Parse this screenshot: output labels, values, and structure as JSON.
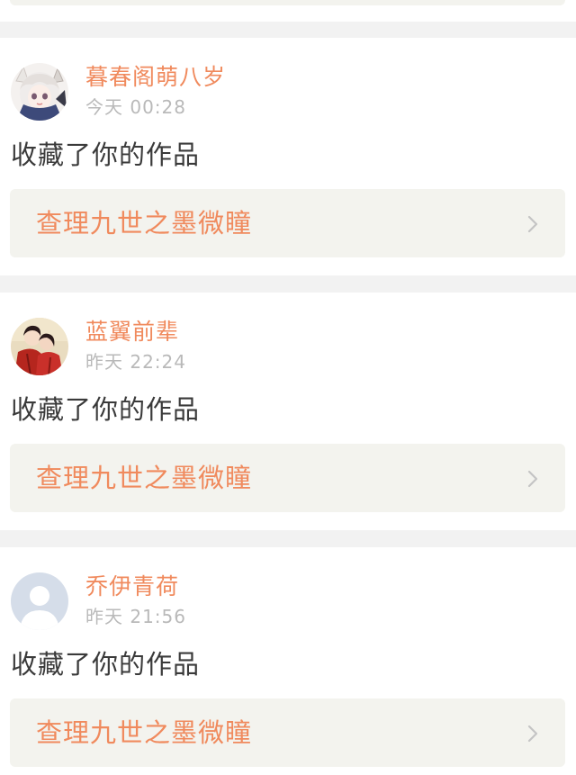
{
  "feed": [
    {
      "user": "暮春阁萌八岁",
      "time": "今天 00:28",
      "action": "收藏了你的作品",
      "work": "查理九世之墨微瞳",
      "avatar_icon": "anime-girl-avatar-icon"
    },
    {
      "user": "蓝翼前辈",
      "time": "昨天 22:24",
      "action": "收藏了你的作品",
      "work": "查理九世之墨微瞳",
      "avatar_icon": "couple-red-robes-avatar-icon"
    },
    {
      "user": "乔伊青荷",
      "time": "昨天 21:56",
      "action": "收藏了你的作品",
      "work": "查理九世之墨微瞳",
      "avatar_icon": "default-person-avatar-icon"
    }
  ],
  "colors": {
    "accent": "#f08a5d",
    "time": "#b9b9b9",
    "text": "#3a3a3a",
    "link_bg": "#f3f3ee",
    "page_bg": "#f2f2f2"
  }
}
